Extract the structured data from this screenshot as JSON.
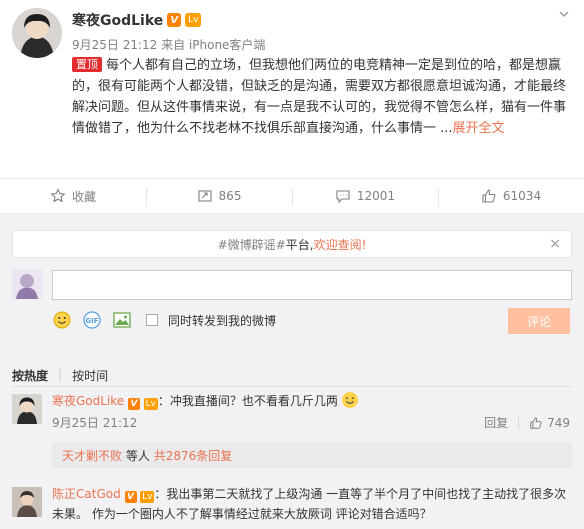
{
  "post": {
    "author": "寒夜GodLike",
    "badge_v": "V",
    "badge_level": "Lv",
    "meta": "9月25日 21:12 来自 iPhone客户端",
    "pin_label": "置顶",
    "text": "每个人都有自己的立场，但我想他们两位的电竞精神一定是到位的哈，都是想赢的，很有可能两个人都没错，但缺乏的是沟通，需要双方都很愿意坦诚沟通，才能最终解决问题。但从这件事情来说，有一点是我不认可的，我觉得不管怎么样，猫有一件事情做错了，他为什么不找老林不找俱乐部直接沟通，什么事情一 ...",
    "expand_label": "展开全文",
    "more_icon": "chevron-down-icon"
  },
  "actions": {
    "favorite": "收藏",
    "repost": "865",
    "comment": "12001",
    "like": "61034"
  },
  "notice": {
    "tag1": "#微博辟谣#",
    "tag2": "平台,",
    "link": "欢迎查阅!",
    "close": "×"
  },
  "composer": {
    "input_value": "",
    "also_repost_label": "同时转发到我的微博",
    "submit_label": "评论"
  },
  "sort": {
    "by_hot": "按热度",
    "by_time": "按时间"
  },
  "comments": [
    {
      "name": "寒夜GodLike",
      "text": "：冲我直播间？也不看看几斤几两",
      "date": "9月25日 21:12",
      "reply_label": "回复",
      "likes": "749",
      "reply_preview": {
        "name": "天才剿不败",
        "text": "等人",
        "count_link": "共2876条回复"
      }
    },
    {
      "name": "陈正CatGod",
      "text": "：我出事第二天就找了上级沟通 一直等了半个月了中间也找了主动找了很多次未果。 作为一个圈内人不了解事情经过就来大放厥词 评论对错合适吗？"
    }
  ],
  "colors": {
    "accent": "#eb7350",
    "pin": "#e32c2e",
    "v_badge": "#ff8200",
    "submit_disabled": "#ffc09f",
    "comment_bg": "#f2f2f5"
  }
}
